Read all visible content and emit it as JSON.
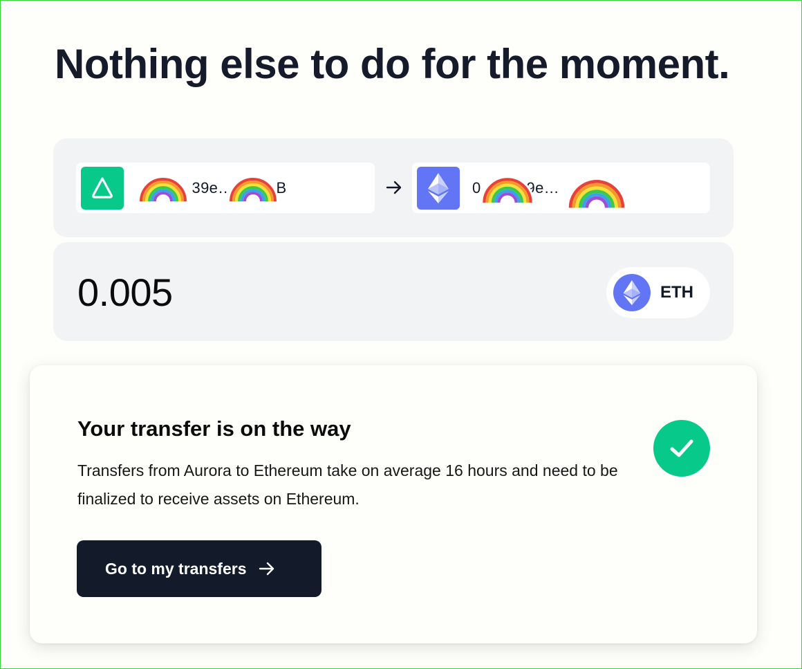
{
  "page": {
    "title": "Nothing else to do for the moment."
  },
  "route": {
    "from": {
      "network_icon": "aurora-logo-icon",
      "address_masked": "0x39e…5B",
      "address_prefix": "0",
      "address_middle": "39e…",
      "address_suffix": "B"
    },
    "arrow_icon": "arrow-right-icon",
    "to": {
      "network_icon": "ethereum-logo-icon",
      "address_prefix": "0",
      "address_middle": "9e…",
      "address_suffix": ""
    }
  },
  "amount": {
    "value": "0.005",
    "token": {
      "icon": "ethereum-logo-icon",
      "symbol": "ETH"
    }
  },
  "status": {
    "title": "Your transfer is on the way",
    "description": "Transfers from Aurora to Ethereum take on average 16 hours and need to be finalized to receive assets on Ethereum.",
    "icon": "checkmark-icon",
    "icon_color": "#06c98a",
    "cta_label": "Go to my transfers",
    "cta_icon": "arrow-right-icon"
  },
  "colors": {
    "aurora_green": "#06c98a",
    "ethereum_blue": "#6275f5",
    "button_dark": "#131a29"
  }
}
